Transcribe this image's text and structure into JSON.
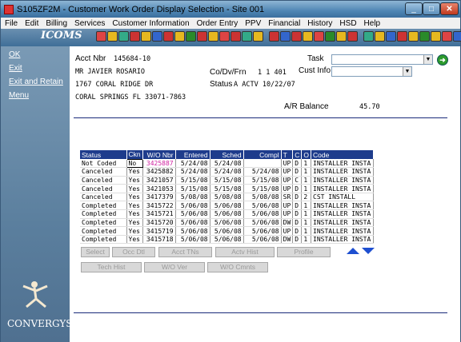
{
  "window": {
    "title": "S105ZF2M - Customer Work Order Display Selection - Site 001"
  },
  "menu": [
    "File",
    "Edit",
    "Billing",
    "Services",
    "Customer Information",
    "Order Entry",
    "PPV",
    "Financial",
    "History",
    "HSD",
    "Help"
  ],
  "toolbar": {
    "logo": "ICOMS"
  },
  "sidebar": {
    "items": [
      "OK",
      "Exit",
      "Exit and Retain",
      "Menu"
    ],
    "brand": "CONVERGYS"
  },
  "account": {
    "acct_label": "Acct Nbr",
    "acct_nbr": "145684-10",
    "name": "MR JAVIER ROSARIO",
    "address1": "1767 CORAL RIDGE DR",
    "address2": "CORAL SPRINGS  FL 33071-7863",
    "codvfrn_label": "Co/Dv/Frn",
    "codvfrn": "1  1 401",
    "status_label": "Status",
    "status": "A ACTV  10/22/07",
    "task_label": "Task",
    "custinfo_label": "Cust Info",
    "ar_label": "A/R Balance",
    "ar_value": "45.70"
  },
  "grid": {
    "headers": [
      "Status",
      "Ckn",
      "W/O Nbr",
      "Entered",
      "Sched",
      "Compl",
      "T",
      "C",
      "O",
      "Code"
    ],
    "rows": [
      [
        "Not Coded",
        "No",
        "3425887",
        "5/24/08",
        "5/24/08",
        "",
        "UP",
        "D",
        "1",
        "INSTALLER INSTA"
      ],
      [
        "Canceled",
        "Yes",
        "3425882",
        "5/24/08",
        "5/24/08",
        "5/24/08",
        "UP",
        "D",
        "1",
        "INSTALLER INSTA"
      ],
      [
        "Canceled",
        "Yes",
        "3421057",
        "5/15/08",
        "5/15/08",
        "5/15/08",
        "UP",
        "C",
        "1",
        "INSTALLER INSTA"
      ],
      [
        "Canceled",
        "Yes",
        "3421053",
        "5/15/08",
        "5/15/08",
        "5/15/08",
        "UP",
        "D",
        "1",
        "INSTALLER INSTA"
      ],
      [
        "Canceled",
        "Yes",
        "3417379",
        "5/08/08",
        "5/08/08",
        "5/08/08",
        "SR",
        "D",
        "2",
        "CST INSTALL"
      ],
      [
        "Completed",
        "Yes",
        "3415722",
        "5/06/08",
        "5/06/08",
        "5/06/08",
        "UP",
        "D",
        "1",
        "INSTALLER INSTA"
      ],
      [
        "Completed",
        "Yes",
        "3415721",
        "5/06/08",
        "5/06/08",
        "5/06/08",
        "UP",
        "D",
        "1",
        "INSTALLER INSTA"
      ],
      [
        "Completed",
        "Yes",
        "3415720",
        "5/06/08",
        "5/06/08",
        "5/06/08",
        "DW",
        "D",
        "1",
        "INSTALLER INSTA"
      ],
      [
        "Completed",
        "Yes",
        "3415719",
        "5/06/08",
        "5/06/08",
        "5/06/08",
        "UP",
        "D",
        "1",
        "INSTALLER INSTA"
      ],
      [
        "Completed",
        "Yes",
        "3415718",
        "5/06/08",
        "5/06/08",
        "5/06/08",
        "DW",
        "D",
        "1",
        "INSTALLER INSTA"
      ]
    ]
  },
  "buttons": {
    "row1": [
      "Select",
      "Occ Dtl",
      "Acct TNs",
      "Actv Hist",
      "Profile"
    ],
    "row2": [
      "Tech Hist",
      "W/O Ver",
      "W/O Cmnts"
    ]
  },
  "colors": {
    "header_bg": "#1e3c8c",
    "sidebar_bg": "#5b7f9e",
    "wo_highlight": "#d01fa0"
  }
}
